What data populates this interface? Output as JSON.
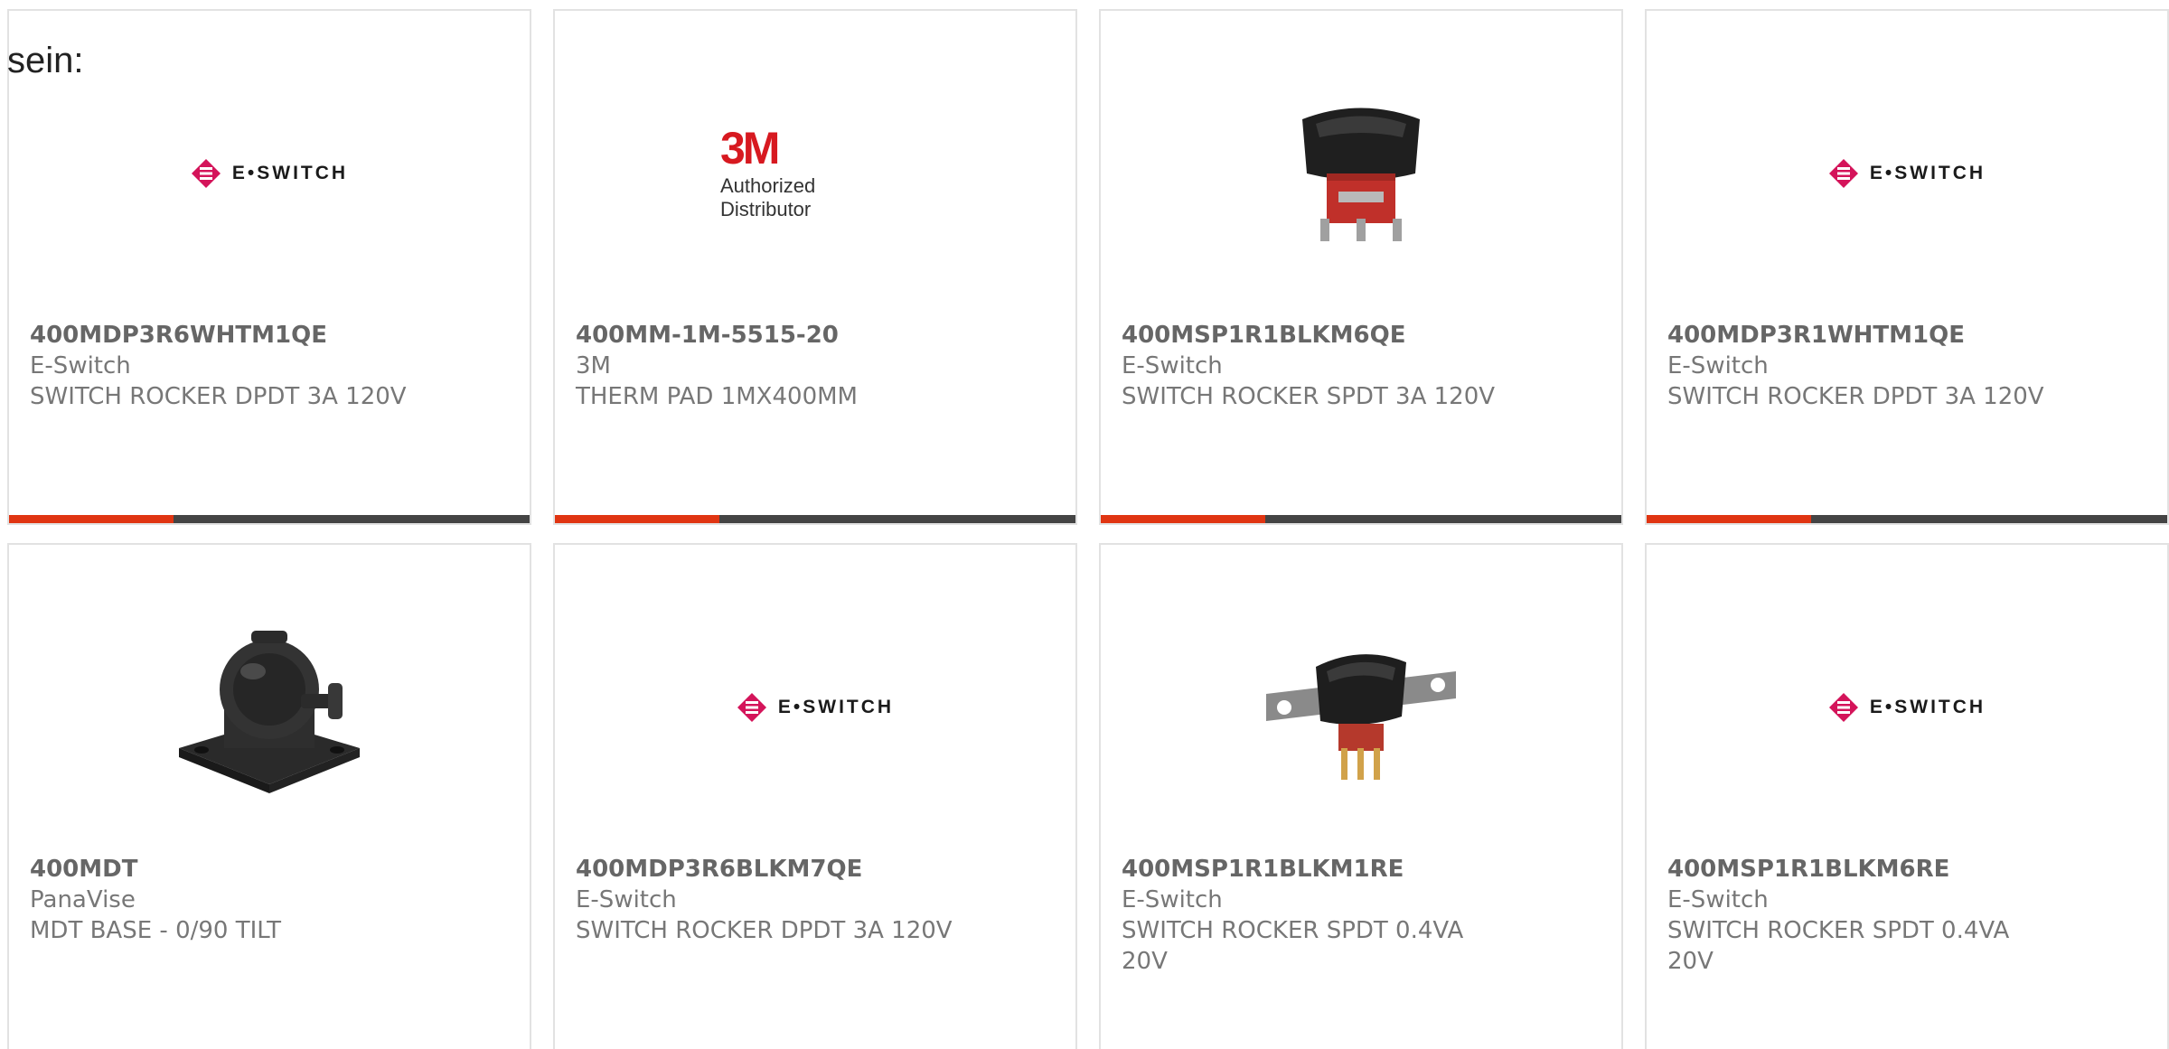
{
  "intro_text": "sein:",
  "colors": {
    "accent_bar": "#e03512",
    "base_bar": "#444444",
    "eswitch_brand": "#d4145a",
    "brand_3m": "#d71920"
  },
  "products": [
    {
      "part_number": "400MDP3R6WHTM1QE",
      "manufacturer": "E-Switch",
      "description": "SWITCH ROCKER DPDT 3A 120V",
      "image": "e-switch-logo",
      "logo_text": "E•SWITCH"
    },
    {
      "part_number": "400MM-1M-5515-20",
      "manufacturer": "3M",
      "description": "THERM PAD 1MX400MM",
      "image": "3m-authorized-distributor-logo",
      "logo_mark": "3M",
      "logo_tagline": "Authorized Distributor"
    },
    {
      "part_number": "400MSP1R1BLKM6QE",
      "manufacturer": "E-Switch",
      "description": "SWITCH ROCKER SPDT 3A 120V",
      "image": "rocker-switch-photo"
    },
    {
      "part_number": "400MDP3R1WHTM1QE",
      "manufacturer": "E-Switch",
      "description": "SWITCH ROCKER DPDT 3A 120V",
      "image": "e-switch-logo",
      "logo_text": "E•SWITCH"
    },
    {
      "part_number": "400MDT",
      "manufacturer": "PanaVise",
      "description": "MDT BASE - 0/90 TILT",
      "image": "mdt-tilt-base-photo"
    },
    {
      "part_number": "400MDP3R6BLKM7QE",
      "manufacturer": "E-Switch",
      "description": "SWITCH ROCKER DPDT 3A 120V",
      "image": "e-switch-logo",
      "logo_text": "E•SWITCH"
    },
    {
      "part_number": "400MSP1R1BLKM1RE",
      "manufacturer": "E-Switch",
      "description": "SWITCH ROCKER SPDT 0.4VA 20V",
      "image": "rocker-switch-bracket-photo"
    },
    {
      "part_number": "400MSP1R1BLKM6RE",
      "manufacturer": "E-Switch",
      "description": "SWITCH ROCKER SPDT 0.4VA 20V",
      "image": "e-switch-logo",
      "logo_text": "E•SWITCH"
    }
  ]
}
